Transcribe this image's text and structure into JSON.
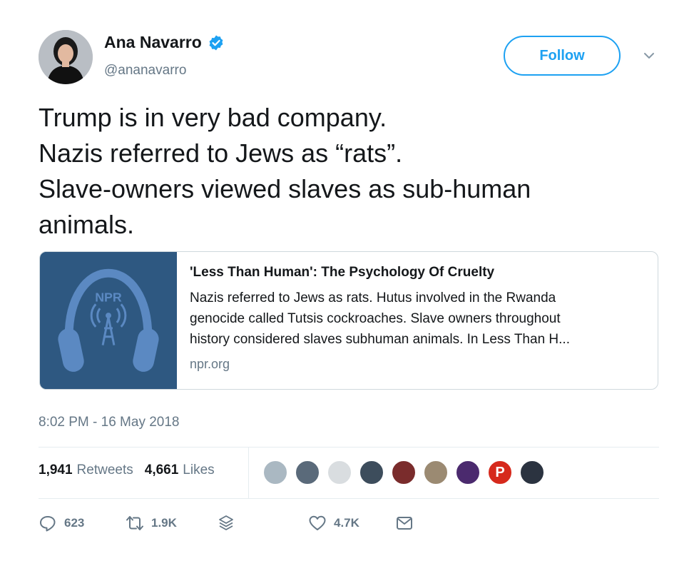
{
  "user": {
    "name": "Ana Navarro",
    "handle": "@ananavarro",
    "follow_label": "Follow"
  },
  "tweet": {
    "lines": [
      "Trump is in very bad company.",
      "Nazis referred to Jews as “rats”.",
      "Slave-owners viewed slaves as sub-human",
      "animals."
    ]
  },
  "card": {
    "image_label": "NPR",
    "title": "'Less Than Human': The Psychology Of Cruelty",
    "description_lines": [
      "Nazis referred to Jews as rats. Hutus involved in the Rwanda",
      "genocide called Tutsis cockroaches. Slave owners throughout",
      "history considered slaves subhuman animals. In Less Than H..."
    ],
    "domain": "npr.org"
  },
  "timestamp": "8:02 PM - 16 May 2018",
  "stats": {
    "retweets_count": "1,941",
    "retweets_label": "Retweets",
    "likes_count": "4,661",
    "likes_label": "Likes"
  },
  "liker_avatars": [
    {
      "color": "#aab8c2",
      "glyph": ""
    },
    {
      "color": "#5a6a7a",
      "glyph": ""
    },
    {
      "color": "#d9dde0",
      "glyph": ""
    },
    {
      "color": "#3d4d5c",
      "glyph": ""
    },
    {
      "color": "#7a2c2c",
      "glyph": ""
    },
    {
      "color": "#9b8a72",
      "glyph": ""
    },
    {
      "color": "#4b2a6e",
      "glyph": ""
    },
    {
      "color": "#d6291c",
      "glyph": "P"
    },
    {
      "color": "#2b3340",
      "glyph": ""
    }
  ],
  "actions": {
    "replies": "623",
    "retweets": "1.9K",
    "likes": "4.7K"
  },
  "colors": {
    "accent": "#1da1f2",
    "secondary_text": "#657786",
    "card_image_bg": "#2e5881"
  }
}
